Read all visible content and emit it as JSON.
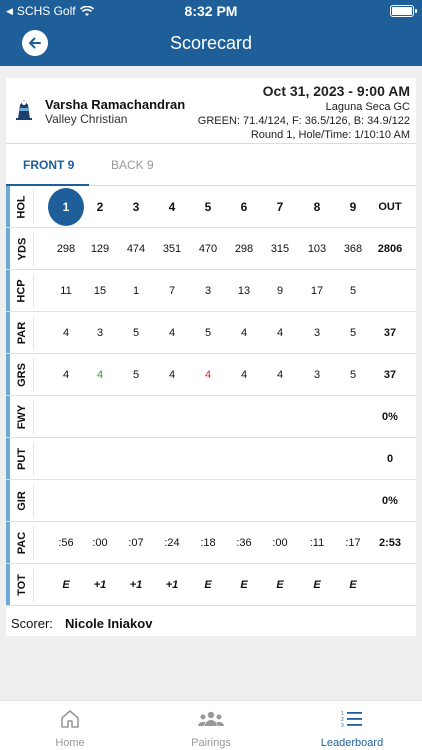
{
  "status": {
    "carrier": "SCHS Golf",
    "time": "8:32 PM"
  },
  "nav": {
    "title": "Scorecard"
  },
  "player": {
    "name": "Varsha Ramachandran",
    "school": "Valley Christian",
    "date": "Oct 31, 2023 - 9:00 AM",
    "course": "Laguna Seca GC",
    "tees": "GREEN: 71.4/124, F: 36.5/126, B: 34.9/122",
    "round": "Round 1, Hole/Time: 1/10:10 AM"
  },
  "tabs": {
    "front": "FRONT 9",
    "back": "BACK 9"
  },
  "scorecard": {
    "current_hole": 1,
    "rows": [
      {
        "label": "HOL",
        "values": [
          "1",
          "2",
          "3",
          "4",
          "5",
          "6",
          "7",
          "8",
          "9"
        ],
        "total": "OUT"
      },
      {
        "label": "YDS",
        "values": [
          "298",
          "129",
          "474",
          "351",
          "470",
          "298",
          "315",
          "103",
          "368"
        ],
        "total": "2806"
      },
      {
        "label": "HCP",
        "values": [
          "11",
          "15",
          "1",
          "7",
          "3",
          "13",
          "9",
          "17",
          "5"
        ],
        "total": ""
      },
      {
        "label": "PAR",
        "values": [
          "4",
          "3",
          "5",
          "4",
          "5",
          "4",
          "4",
          "3",
          "5"
        ],
        "total": "37"
      },
      {
        "label": "GRS",
        "values": [
          "4",
          "4",
          "5",
          "4",
          "4",
          "4",
          "4",
          "3",
          "5"
        ],
        "total": "37"
      },
      {
        "label": "FWY",
        "values": [
          "",
          "",
          "",
          "",
          "",
          "",
          "",
          "",
          ""
        ],
        "total": "0%"
      },
      {
        "label": "PUT",
        "values": [
          "",
          "",
          "",
          "",
          "",
          "",
          "",
          "",
          ""
        ],
        "total": "0"
      },
      {
        "label": "GIR",
        "values": [
          "",
          "",
          "",
          "",
          "",
          "",
          "",
          "",
          ""
        ],
        "total": "0%"
      },
      {
        "label": "PAC",
        "values": [
          ":56",
          ":00",
          ":07",
          ":24",
          ":18",
          ":36",
          ":00",
          ":11",
          ":17"
        ],
        "total": "2:53"
      },
      {
        "label": "TOT",
        "values": [
          "E",
          "+1",
          "+1",
          "+1",
          "E",
          "E",
          "E",
          "E",
          "E"
        ],
        "total": ""
      }
    ],
    "score_colors": {
      "birdie": "#2e9e2e",
      "bogey": "#d62828"
    },
    "grs_value_colors": [
      "",
      "birdie",
      "",
      "",
      "bogey",
      "",
      "",
      "",
      ""
    ]
  },
  "scorer": {
    "label": "Scorer:",
    "name": "Nicole Iniakov"
  },
  "tabbar": {
    "home": "Home",
    "pairings": "Pairings",
    "leaderboard": "Leaderboard"
  },
  "colors": {
    "primary": "#1f5f99",
    "row_accent": "#6aa9d8"
  }
}
